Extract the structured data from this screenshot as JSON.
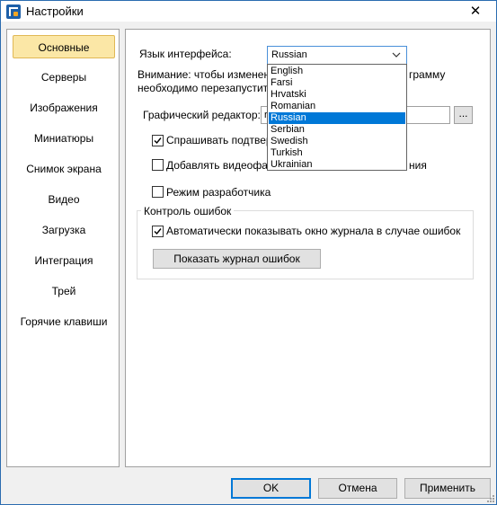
{
  "window": {
    "title": "Настройки",
    "close_glyph": "✕"
  },
  "sidebar": {
    "items": [
      {
        "label": "Основные",
        "active": true
      },
      {
        "label": "Серверы"
      },
      {
        "label": "Изображения"
      },
      {
        "label": "Миниатюры"
      },
      {
        "label": "Снимок экрана"
      },
      {
        "label": "Видео"
      },
      {
        "label": "Загрузка"
      },
      {
        "label": "Интеграция"
      },
      {
        "label": "Трей"
      },
      {
        "label": "Горячие клавиши"
      }
    ]
  },
  "general": {
    "language_label": "Язык интерфейса:",
    "language_value": "Russian",
    "language_options": [
      "English",
      "Farsi",
      "Hrvatski",
      "Romanian",
      "Russian",
      "Serbian",
      "Swedish",
      "Turkish",
      "Ukrainian"
    ],
    "warning_line1_left": "Внимание: чтобы изменения",
    "warning_line1_right": "грамму",
    "warning_line2": "необходимо перезапустить.",
    "editor_label": "Графический редактор:",
    "editor_value": "r",
    "browse_label": "...",
    "confirm_checkbox": {
      "label": "Спрашивать подтверж",
      "checked": true
    },
    "add_video_checkbox": {
      "label_left": "Добавлять видеофайл",
      "label_right": "ния",
      "checked": false
    },
    "dev_mode_checkbox": {
      "label": "Режим разработчика",
      "checked": false
    }
  },
  "error_control": {
    "title": "Контроль ошибок",
    "auto_show_checkbox": {
      "label": "Автоматически показывать окно журнала в случае ошибок",
      "checked": true
    },
    "show_log_button": "Показать журнал ошибок"
  },
  "buttons": {
    "ok": "OK",
    "cancel": "Отмена",
    "apply": "Применить"
  },
  "icons": {
    "app": "app-logo-icon",
    "close": "close-icon",
    "dropdown": "chevron-down-icon",
    "check": "checkmark-icon",
    "grip": "resize-grip-icon"
  },
  "colors": {
    "selection": "#0078d7",
    "active_nav": "#fbe7a6",
    "focus_border": "#4a90d9"
  }
}
